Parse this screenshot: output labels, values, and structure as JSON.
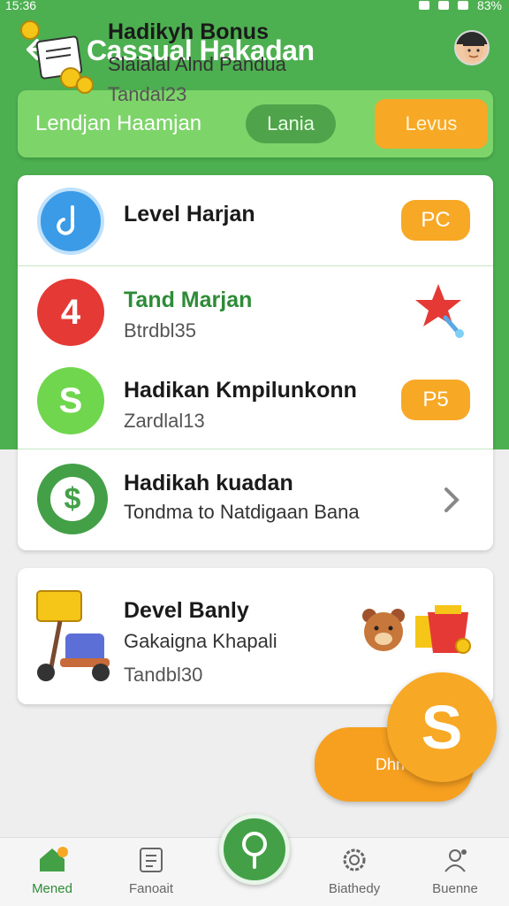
{
  "status_bar": {
    "time": "15:36",
    "battery": "83%"
  },
  "app_bar": {
    "title": "Cassual Hakadan"
  },
  "filter": {
    "label": "Lendjan Haamjan",
    "pill_secondary": "Lania",
    "pill_primary": "Levus"
  },
  "list": {
    "items": [
      {
        "title": "Level Harjan",
        "subtitle": "",
        "badge": "PC",
        "icon_text": "",
        "color": "#3b9be6"
      },
      {
        "title": "Tand Marjan",
        "subtitle": "Btrdbl35",
        "badge": "",
        "icon_text": "4",
        "color": "#e53935"
      },
      {
        "title": "Hadikan Kmpilunkonn",
        "subtitle": "Zardlal13",
        "badge": "P5",
        "icon_text": "S",
        "color": "#6fd64e"
      },
      {
        "title": "Hadikah kuadan",
        "subtitle": "Tondma to Natdigaan Bana",
        "badge": "",
        "icon_text": "$",
        "color": "#43a047"
      }
    ]
  },
  "daily": {
    "title": "Devel Banly",
    "subtitle": "Gakaigna Khapali",
    "meta": "Tandbl30"
  },
  "bonus": {
    "title": "Hadikyh Bonus",
    "subtitle": "Slaialal Alnd Pandua",
    "meta": "Tandal23",
    "pill_text": "Dhnsan",
    "fab_text": "S"
  },
  "bottom_nav": {
    "items": [
      {
        "label": "Mened"
      },
      {
        "label": "Fanoait"
      },
      {
        "label": "Biathedy"
      },
      {
        "label": "Buenne"
      }
    ]
  },
  "colors": {
    "green": "#4caf50",
    "light_green": "#7dd56a",
    "orange": "#f7a825",
    "bonus_bg": "#f8df84"
  }
}
